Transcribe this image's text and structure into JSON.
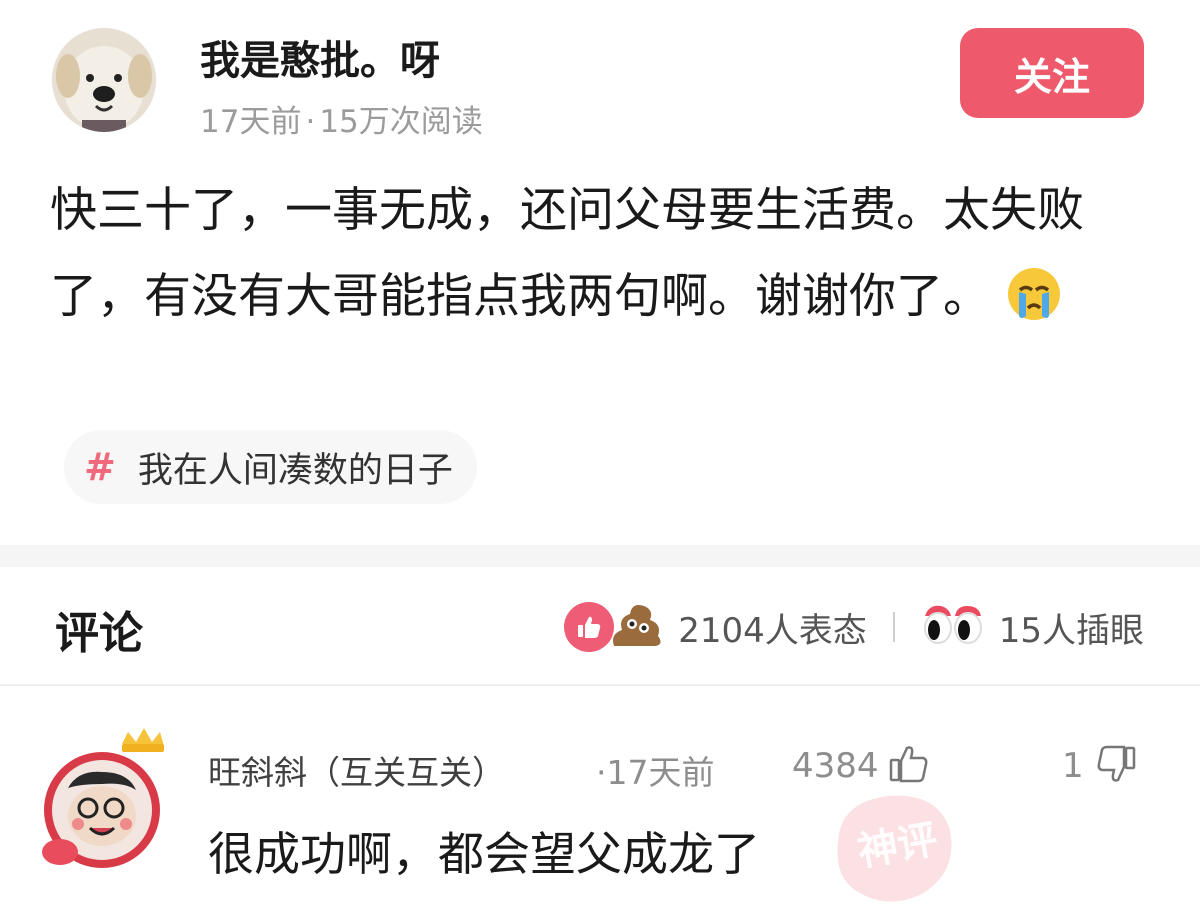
{
  "post": {
    "author": "我是憨批。呀",
    "time_ago": "17天前",
    "separator": "·",
    "views": "15万次阅读",
    "follow_label": "关注",
    "text": "快三十了，一事无成，还问父母要生活费。太失败了，有没有大哥能指点我两句啊。谢谢你了。",
    "topic_symbol": "#",
    "topic": "我在人间凑数的日子"
  },
  "comments_header": {
    "title": "评论",
    "reaction_count": "2104人表态",
    "peek_count": "15人插眼"
  },
  "comment": {
    "author": "旺斜斜（互关互关）",
    "time_ago": "·17天前",
    "likes": "4384",
    "dislikes": "1",
    "text": "很成功啊，都会望父成龙了",
    "badge_text": "神评"
  },
  "colors": {
    "accent": "#ee5a6b",
    "meta_gray": "#9b9b9b",
    "topic_hash": "#f06a7d"
  },
  "icons": [
    "dog-avatar",
    "crying-face-icon",
    "hash-icon",
    "like-reaction-icon",
    "poop-reaction-icon",
    "peeking-eyes-icon",
    "thumbs-up-icon",
    "thumbs-down-icon",
    "crown-icon",
    "shenping-stamp-icon"
  ]
}
